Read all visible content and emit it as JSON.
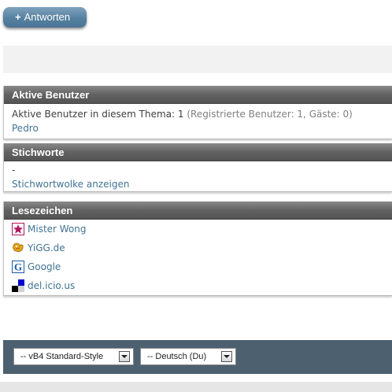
{
  "reply_button": {
    "plus": "+",
    "label": "Antworten"
  },
  "active_users": {
    "title": "Aktive Benutzer",
    "summary_label": "Aktive Benutzer in diesem Thema: 1",
    "summary_detail": "(Registrierte Benutzer: 1, Gäste: 0)",
    "users": [
      "Pedro"
    ]
  },
  "tags": {
    "title": "Stichworte",
    "value": "-",
    "cloud_link": "Stichwortwolke anzeigen"
  },
  "bookmarks": {
    "title": "Lesezeichen",
    "items": [
      {
        "label": "Mister Wong",
        "icon": "mister-wong-icon",
        "color": "#b0175d"
      },
      {
        "label": "YiGG.de",
        "icon": "yigg-icon",
        "color": "#e6a21b"
      },
      {
        "label": "Google",
        "icon": "google-icon",
        "color": "#1c5aa8"
      },
      {
        "label": "del.icio.us",
        "icon": "delicious-icon",
        "color": "#0000cc"
      }
    ]
  },
  "footer": {
    "style_select": "-- vB4 Standard-Style",
    "language_select": "-- Deutsch (Du)"
  }
}
